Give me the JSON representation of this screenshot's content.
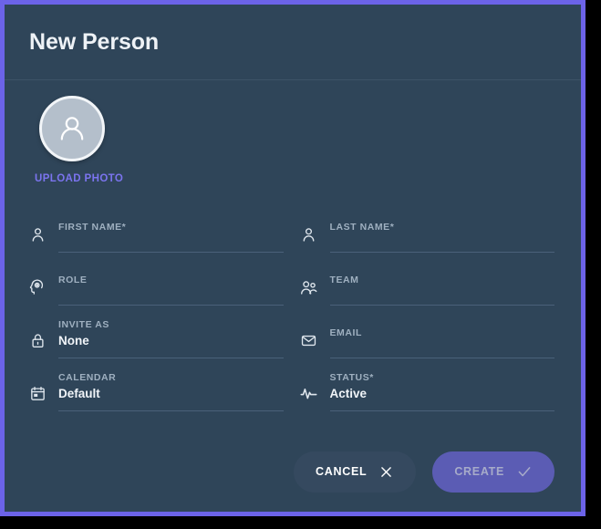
{
  "dialog": {
    "title": "New Person",
    "accent_color": "#6c63e8",
    "surface_color": "#2f4559"
  },
  "avatar": {
    "icon": "person-avatar-icon",
    "upload_label": "UPLOAD PHOTO",
    "upload_color": "#7b74ef"
  },
  "form": {
    "fields": [
      {
        "name": "first-name",
        "icon": "person-icon",
        "label": "FIRST NAME*",
        "value": ""
      },
      {
        "name": "last-name",
        "icon": "person-icon",
        "label": "LAST NAME*",
        "value": ""
      },
      {
        "name": "role",
        "icon": "head-gear-icon",
        "label": "ROLE",
        "value": ""
      },
      {
        "name": "team",
        "icon": "people-icon",
        "label": "TEAM",
        "value": ""
      },
      {
        "name": "invite-as",
        "icon": "lock-icon",
        "label": "INVITE AS",
        "value": "None"
      },
      {
        "name": "email",
        "icon": "envelope-icon",
        "label": "EMAIL",
        "value": ""
      },
      {
        "name": "calendar",
        "icon": "calendar-icon",
        "label": "CALENDAR",
        "value": "Default"
      },
      {
        "name": "status",
        "icon": "activity-icon",
        "label": "STATUS*",
        "value": "Active"
      }
    ]
  },
  "footer": {
    "cancel_label": "CANCEL",
    "cancel_icon": "close-icon",
    "create_label": "CREATE",
    "create_icon": "check-icon",
    "create_color": "#5b5cb4"
  }
}
